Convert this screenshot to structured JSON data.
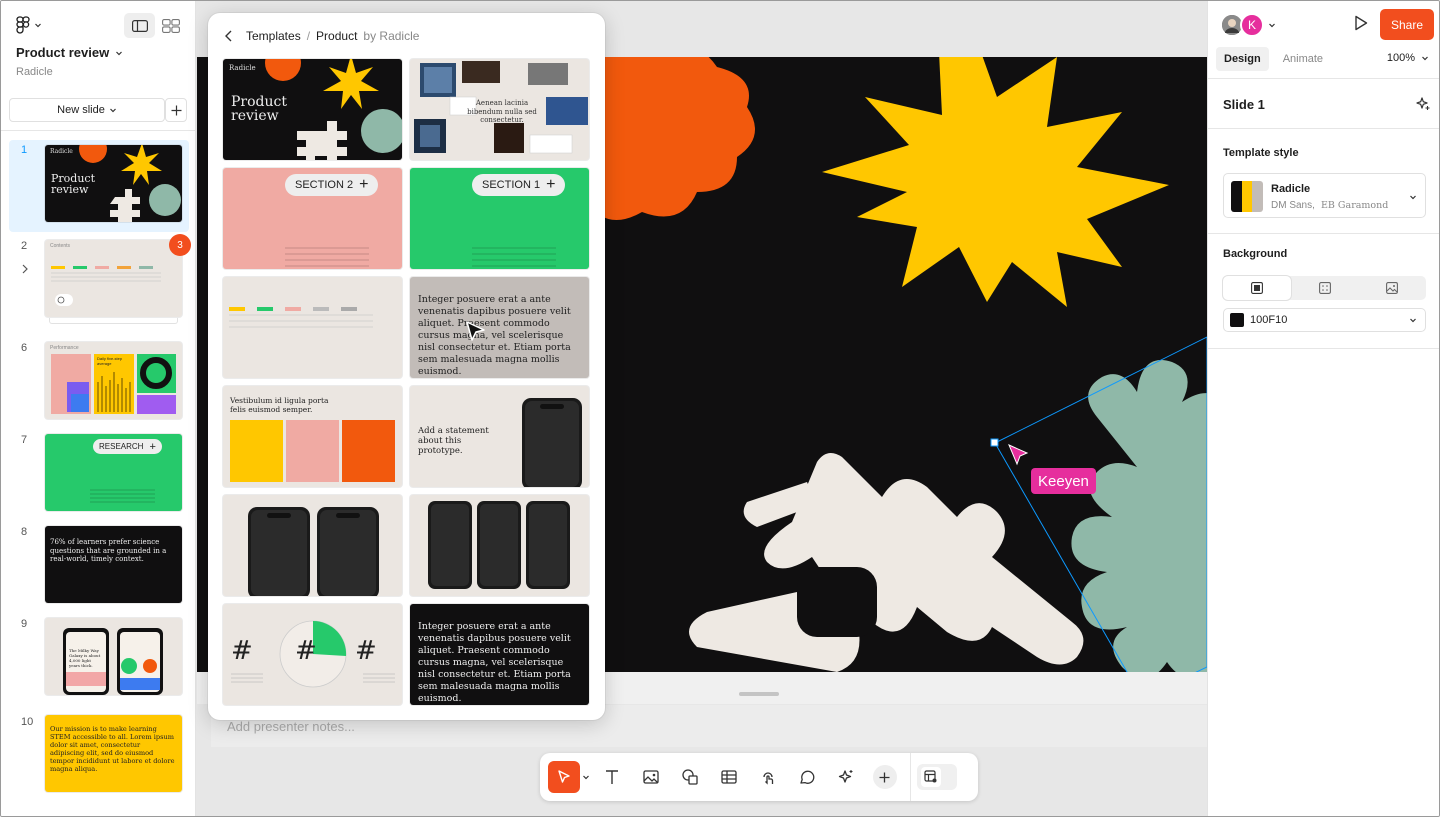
{
  "header": {
    "file_name": "Product review",
    "team": "Radicle",
    "new_slide_label": "New slide"
  },
  "slides": [
    {
      "number": "1",
      "title": "Product review",
      "brand": "Radicle"
    },
    {
      "number": "2",
      "title": "Contents",
      "comment_count": "3"
    },
    {
      "number": "6",
      "title": "Performance",
      "subtitle": "Daily five-step average"
    },
    {
      "number": "7",
      "section": "RESEARCH"
    },
    {
      "number": "8",
      "text": "76% of learners prefer science questions that are grounded in a real-world, timely context."
    },
    {
      "number": "9",
      "phone_heading": "The Milky Way Galaxy is about 4,000 light years thick."
    },
    {
      "number": "10",
      "text": "Our mission is to make learning STEM accessible to all. Lorem ipsum dolor sit amet, consectetur adipiscing elit, sed do eiusmod tempor incididunt ut labore et dolore magna aliqua."
    }
  ],
  "popup": {
    "crumb_root": "Templates",
    "crumb_sep": "/",
    "crumb_current": "Product",
    "crumb_by": "by Radicle",
    "tiles": {
      "cover_brand": "Radicle",
      "cover_title": "Product review",
      "collage_text": "Aenean lacinia bibendum nulla sed consectetur.",
      "section2": "SECTION 2",
      "section1": "SECTION 1",
      "quote_text": "Integer posuere erat a ante venenatis dapibus posuere velit aliquet. Praesent commodo cursus magna, vel scelerisque nisl consectetur et. Etiam porta sem malesuada magna mollis euismod.",
      "cards_heading": "Vestibulum id ligula porta felis euismod semper.",
      "statement": "Add a statement about this prototype.",
      "hash": "#",
      "dark_quote": "Integer posuere erat a ante venenatis dapibus posuere velit aliquet. Praesent commodo cursus magna, vel scelerisque nisl consectetur et. Etiam porta sem malesuada magna mollis euismod."
    }
  },
  "canvas": {
    "notes_placeholder": "Add presenter notes...",
    "cursor_user": "Keeyen"
  },
  "right_panel": {
    "avatar_initial": "K",
    "share_label": "Share",
    "tab_design": "Design",
    "tab_animate": "Animate",
    "zoom": "100%",
    "slide_title": "Slide 1",
    "template_style_label": "Template style",
    "style_name": "Radicle",
    "style_font_1": "DM Sans,",
    "style_font_2": "EB Garamond",
    "background_label": "Background",
    "background_color": "100F10"
  },
  "colors": {
    "accent": "#f24e1e",
    "selection": "#0d99ff",
    "collaborator": "#e62e9d",
    "slide_bg": "#100f10",
    "yellow": "#ffc700",
    "sage": "#8fb8a8",
    "green": "#26c96b",
    "pink": "#f0aaa3"
  }
}
